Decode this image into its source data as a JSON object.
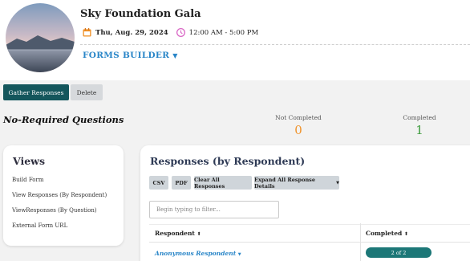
{
  "event": {
    "title": "Sky Foundation Gala",
    "date": "Thu, Aug. 29, 2024",
    "time": "12:00 AM - 5:00 PM",
    "forms_builder_label": "FORMS BUILDER"
  },
  "actions": {
    "gather_label": "Gather Responses",
    "delete_label": "Delete"
  },
  "form_heading": "No-Required Questions",
  "stats": {
    "not_completed_label": "Not Completed",
    "not_completed_value": "0",
    "completed_label": "Completed",
    "completed_value": "1"
  },
  "views": {
    "title": "Views",
    "items": [
      "Build Form",
      "View Responses (By Respondent)",
      "ViewResponses (By Question)",
      "External Form URL"
    ]
  },
  "responses": {
    "title": "Responses (by Respondent)",
    "toolbar": [
      "CSV",
      "PDF",
      "Clear All Responses",
      "Expand All Response Details"
    ],
    "filter_placeholder": "Begin typing to filter...",
    "columns": [
      "Respondent",
      "Completed"
    ],
    "rows": [
      {
        "respondent": "Anonymous Respondent",
        "completed": "2 of 2"
      }
    ]
  },
  "colors": {
    "brand_teal": "#14565c",
    "link_blue": "#2a86c8",
    "not_completed_orange": "#f0932b",
    "completed_green": "#3a9a3a"
  }
}
